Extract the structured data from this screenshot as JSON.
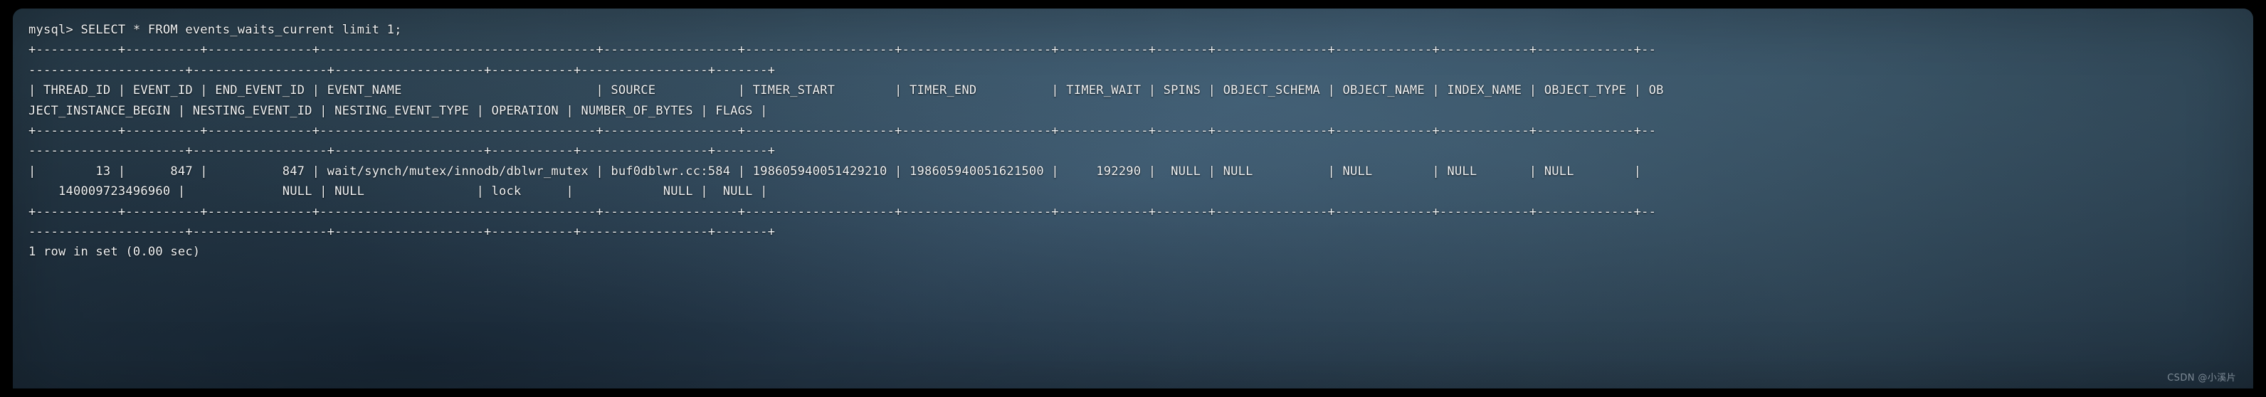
{
  "window": {
    "background_color": "#31495c",
    "text_color": "#f2f5f7",
    "page_background": "#000000",
    "corner_radius_px": 14
  },
  "terminal": {
    "prompt": "mysql>",
    "command": "SELECT * FROM events_waits_current limit 1;",
    "prompt_line": "mysql> SELECT * FROM events_waits_current limit 1;",
    "status_line": "1 row in set (0.00 sec)",
    "row_count": 1,
    "elapsed_seconds": "0.00"
  },
  "query": {
    "statement": "SELECT * FROM events_waits_current limit 1;",
    "table": "events_waits_current",
    "limit": 1
  },
  "result_table": {
    "columns": [
      "THREAD_ID",
      "EVENT_ID",
      "END_EVENT_ID",
      "EVENT_NAME",
      "SOURCE",
      "TIMER_START",
      "TIMER_END",
      "TIMER_WAIT",
      "SPINS",
      "OBJECT_SCHEMA",
      "OBJECT_NAME",
      "INDEX_NAME",
      "OBJECT_TYPE",
      "OBJECT_INSTANCE_BEGIN",
      "NESTING_EVENT_ID",
      "NESTING_EVENT_TYPE",
      "OPERATION",
      "NUMBER_OF_BYTES",
      "FLAGS"
    ],
    "rows": [
      {
        "THREAD_ID": "13",
        "EVENT_ID": "847",
        "END_EVENT_ID": "847",
        "EVENT_NAME": "wait/synch/mutex/innodb/dblwr_mutex",
        "SOURCE": "buf0dblwr.cc:584",
        "TIMER_START": "198605940051429210",
        "TIMER_END": "198605940051621500",
        "TIMER_WAIT": "192290",
        "SPINS": "NULL",
        "OBJECT_SCHEMA": "NULL",
        "OBJECT_NAME": "NULL",
        "INDEX_NAME": "NULL",
        "OBJECT_TYPE": "NULL",
        "OBJECT_INSTANCE_BEGIN": "140009723496960",
        "NESTING_EVENT_ID": "NULL",
        "NESTING_EVENT_TYPE": "NULL",
        "OPERATION": "lock",
        "NUMBER_OF_BYTES": "NULL",
        "FLAGS": "NULL"
      }
    ]
  },
  "lines": [
    "mysql> SELECT * FROM events_waits_current limit 1;",
    "+-----------+----------+--------------+-------------------------------------+------------------+--------------------+--------------------+------------+-------+---------------+-------------+------------+-------------+--",
    "---------------------+------------------+--------------------+-----------+-----------------+-------+",
    "| THREAD_ID | EVENT_ID | END_EVENT_ID | EVENT_NAME                          | SOURCE           | TIMER_START        | TIMER_END          | TIMER_WAIT | SPINS | OBJECT_SCHEMA | OBJECT_NAME | INDEX_NAME | OBJECT_TYPE | OB",
    "JECT_INSTANCE_BEGIN | NESTING_EVENT_ID | NESTING_EVENT_TYPE | OPERATION | NUMBER_OF_BYTES | FLAGS |",
    "+-----------+----------+--------------+-------------------------------------+------------------+--------------------+--------------------+------------+-------+---------------+-------------+------------+-------------+--",
    "---------------------+------------------+--------------------+-----------+-----------------+-------+",
    "|        13 |      847 |          847 | wait/synch/mutex/innodb/dblwr_mutex | buf0dblwr.cc:584 | 198605940051429210 | 198605940051621500 |     192290 |  NULL | NULL          | NULL        | NULL       | NULL        |",
    "    140009723496960 |             NULL | NULL               | lock      |            NULL |  NULL |",
    "+-----------+----------+--------------+-------------------------------------+------------------+--------------------+--------------------+------------+-------+---------------+-------------+------------+-------------+--",
    "---------------------+------------------+--------------------+-----------+-----------------+-------+",
    "1 row in set (0.00 sec)"
  ],
  "watermark": {
    "text": "CSDN @小溪片"
  }
}
